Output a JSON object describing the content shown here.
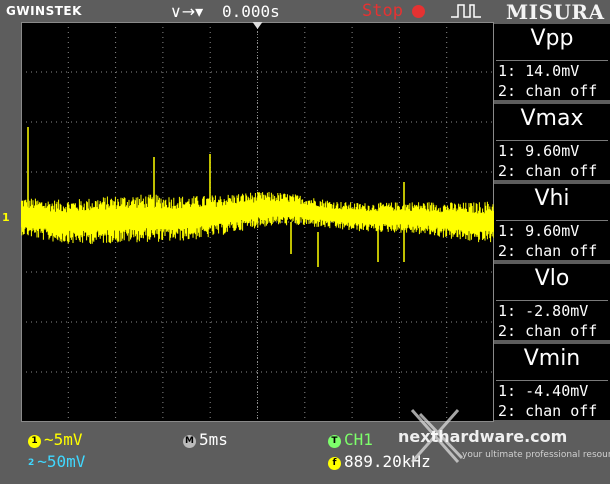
{
  "header": {
    "brand": "GWINSTEK",
    "trigger_icons": "∨→▾",
    "time_position": "0.000s",
    "run_state": "Stop",
    "menu_title": "MISURA"
  },
  "channel_marker": "1",
  "measurements": [
    {
      "name": "Vpp",
      "ch1": "1: 14.0mV",
      "ch2": "2: chan off"
    },
    {
      "name": "Vmax",
      "ch1": "1: 9.60mV",
      "ch2": "2: chan off"
    },
    {
      "name": "Vhi",
      "ch1": "1: 9.60mV",
      "ch2": "2: chan off"
    },
    {
      "name": "Vlo",
      "ch1": "1: -2.80mV",
      "ch2": "2: chan off"
    },
    {
      "name": "Vmin",
      "ch1": "1: -4.40mV",
      "ch2": "2: chan off"
    }
  ],
  "footer": {
    "ch1_badge": "1",
    "ch1_scale": "~5mV",
    "ch2_badge": "2",
    "ch2_scale": "~50mV",
    "timebase_badge": "M",
    "timebase": "5ms",
    "trigger_badge": "T",
    "trigger_source": "CH1",
    "freq_badge": "f",
    "frequency": "889.20kHz",
    "watermark": "nexthardware.com",
    "watermark_tagline": "your ultimate professional resource"
  },
  "colors": {
    "ch1": "#ffff00",
    "ch2": "#40d8ff",
    "stop": "#e63232",
    "trigger": "#7dff6b",
    "grid": "#8a8a8a"
  }
}
